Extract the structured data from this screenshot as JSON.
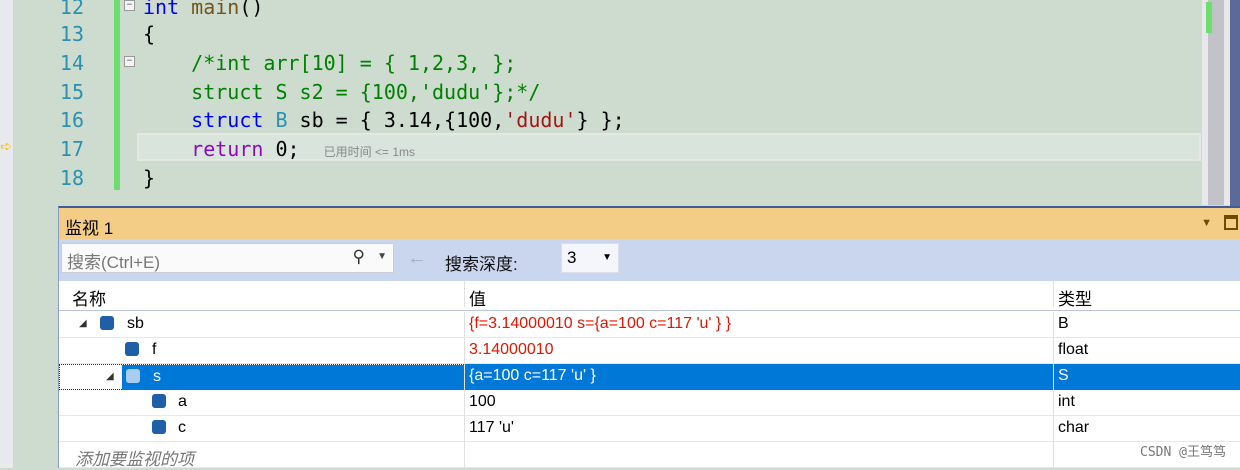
{
  "editor": {
    "lines": [
      {
        "num": "12"
      },
      {
        "num": "13"
      },
      {
        "num": "14"
      },
      {
        "num": "15"
      },
      {
        "num": "16"
      },
      {
        "num": "17"
      },
      {
        "num": "18"
      }
    ],
    "code": {
      "l12a": "int",
      "l12b": " main",
      "l12c": "()",
      "l13": "{",
      "l14": "    /*int arr[10] = { 1,2,3, };",
      "l15": "    struct S s2 = {100,'dudu'};*/",
      "l16a": "    struct",
      "l16b": " B",
      "l16c": " sb = { 3.14,{100,",
      "l16d": "'dudu'",
      "l16e": "} };",
      "l17a": "    return",
      "l17b": " 0;  ",
      "l18": "}"
    },
    "elapsed_hint": "已用时间 <= 1ms"
  },
  "watch": {
    "title": "监视 1",
    "search_placeholder": "搜索(Ctrl+E)",
    "depth_label": "搜索深度:",
    "depth_value": "3",
    "columns": [
      "名称",
      "值",
      "类型"
    ],
    "rows": [
      {
        "name": "sb",
        "value": "{f=3.14000010 s={a=100 c=117 'u' } }",
        "type": "B"
      },
      {
        "name": "f",
        "value": "3.14000010",
        "type": "float"
      },
      {
        "name": "s",
        "value": "{a=100 c=117 'u' }",
        "type": "S"
      },
      {
        "name": "a",
        "value": "100",
        "type": "int"
      },
      {
        "name": "c",
        "value": "117 'u'",
        "type": "char"
      }
    ],
    "add_item": "添加要监视的项"
  },
  "watermark": "CSDN @王笃笃"
}
